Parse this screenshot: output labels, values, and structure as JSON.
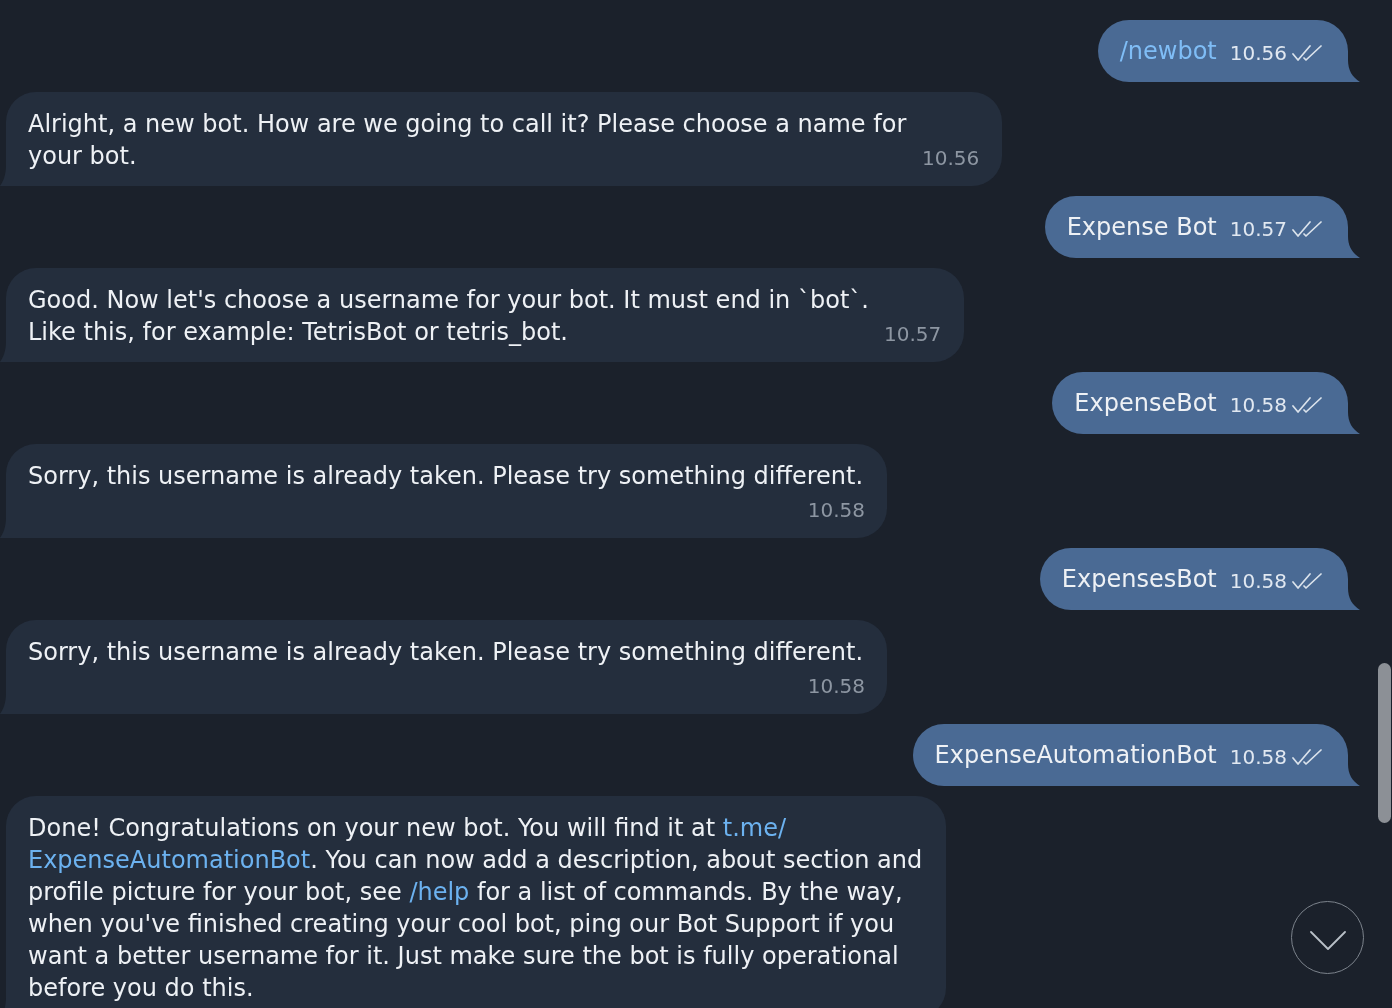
{
  "messages": [
    {
      "kind": "outgoing",
      "segments": [
        {
          "kind": "link",
          "text": "/newbot"
        }
      ],
      "time": "10.56",
      "read": true
    },
    {
      "kind": "incoming",
      "segments": [
        {
          "kind": "text",
          "text": "Alright, a new bot. How are we going to call it? Please choose a name for your bot."
        }
      ],
      "time": "10.56"
    },
    {
      "kind": "outgoing",
      "segments": [
        {
          "kind": "text",
          "text": "Expense Bot"
        }
      ],
      "time": "10.57",
      "read": true
    },
    {
      "kind": "incoming",
      "segments": [
        {
          "kind": "text",
          "text": "Good. Now let's choose a username for your bot. It must end in `bot`.\nLike this, for example: TetrisBot or tetris_bot."
        }
      ],
      "time": "10.57"
    },
    {
      "kind": "outgoing",
      "segments": [
        {
          "kind": "text",
          "text": "ExpenseBot"
        }
      ],
      "time": "10.58",
      "read": true
    },
    {
      "kind": "incoming",
      "segments": [
        {
          "kind": "text",
          "text": "Sorry, this username is already taken. Please try something different."
        }
      ],
      "time": "10.58"
    },
    {
      "kind": "outgoing",
      "segments": [
        {
          "kind": "text",
          "text": "ExpensesBot"
        }
      ],
      "time": "10.58",
      "read": true
    },
    {
      "kind": "incoming",
      "segments": [
        {
          "kind": "text",
          "text": "Sorry, this username is already taken. Please try something different."
        }
      ],
      "time": "10.58"
    },
    {
      "kind": "outgoing",
      "segments": [
        {
          "kind": "text",
          "text": "ExpenseAutomationBot"
        }
      ],
      "time": "10.58",
      "read": true
    },
    {
      "kind": "incoming",
      "segments": [
        {
          "kind": "text",
          "text": "Done! Congratulations on your new bot. You will find it at "
        },
        {
          "kind": "link",
          "text": "t.me/"
        },
        {
          "kind": "link",
          "text": "ExpenseAutomationBot"
        },
        {
          "kind": "text",
          "text": ". You can now add a description, about section and profile picture for your bot, see "
        },
        {
          "kind": "link",
          "text": "/help"
        },
        {
          "kind": "text",
          "text": " for a list of commands. By the way, when you've finished creating your cool bot, ping our Bot Support if you want a better username for it. Just make sure the bot is fully operational before you do this."
        }
      ]
    }
  ]
}
